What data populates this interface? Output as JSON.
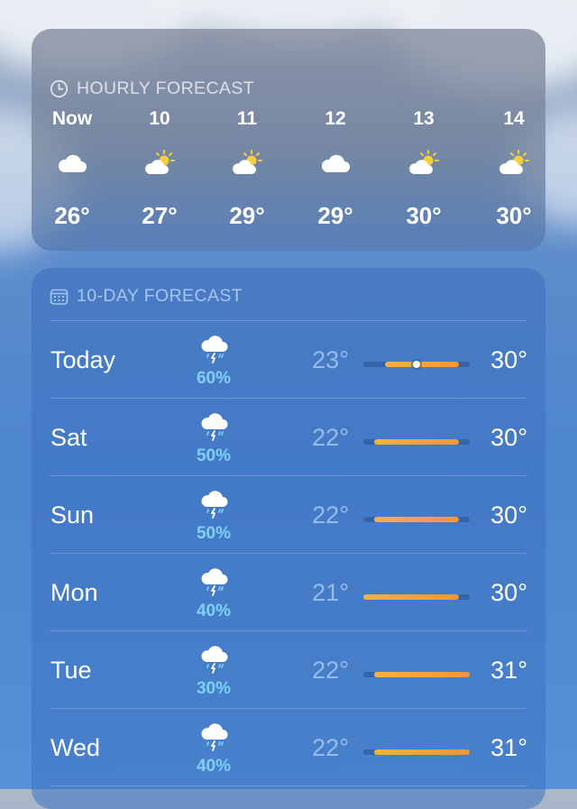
{
  "hourly": {
    "header": "HOURLY FORECAST",
    "items": [
      {
        "time": "Now",
        "icon": "cloud-icon",
        "temp": "26°"
      },
      {
        "time": "10",
        "icon": "partly-sunny-icon",
        "temp": "27°"
      },
      {
        "time": "11",
        "icon": "partly-sunny-icon",
        "temp": "29°"
      },
      {
        "time": "12",
        "icon": "cloud-icon",
        "temp": "29°"
      },
      {
        "time": "13",
        "icon": "partly-sunny-icon",
        "temp": "30°"
      },
      {
        "time": "14",
        "icon": "partly-sunny-icon",
        "temp": "30°"
      }
    ]
  },
  "daily": {
    "header": "10-DAY FORECAST",
    "range_min": 21,
    "range_max": 31,
    "current_temp": 26,
    "days": [
      {
        "day": "Today",
        "icon": "cloud-rain-lightning-icon",
        "precip": "60%",
        "low": "23°",
        "high": "30°",
        "low_value": 23,
        "high_value": 30,
        "current": true
      },
      {
        "day": "Sat",
        "icon": "cloud-rain-lightning-icon",
        "precip": "50%",
        "low": "22°",
        "high": "30°",
        "low_value": 22,
        "high_value": 30
      },
      {
        "day": "Sun",
        "icon": "cloud-rain-lightning-icon",
        "precip": "50%",
        "low": "22°",
        "high": "30°",
        "low_value": 22,
        "high_value": 30
      },
      {
        "day": "Mon",
        "icon": "cloud-rain-lightning-icon",
        "precip": "40%",
        "low": "21°",
        "high": "30°",
        "low_value": 21,
        "high_value": 30
      },
      {
        "day": "Tue",
        "icon": "cloud-rain-lightning-icon",
        "precip": "30%",
        "low": "22°",
        "high": "31°",
        "low_value": 22,
        "high_value": 31
      },
      {
        "day": "Wed",
        "icon": "cloud-rain-lightning-icon",
        "precip": "40%",
        "low": "22°",
        "high": "31°",
        "low_value": 22,
        "high_value": 31
      }
    ]
  },
  "colors": {
    "bar_start": "#efb245",
    "bar_end": "#f0963c",
    "precip": "#7fd0f6",
    "sun": "#f6cd3c"
  }
}
